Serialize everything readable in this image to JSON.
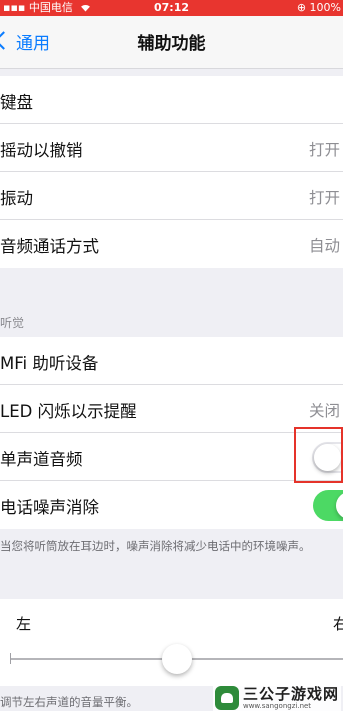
{
  "status_bar": {
    "carrier": "中国电信",
    "time": "07:12",
    "battery": "100%"
  },
  "nav": {
    "back_label": "通用",
    "title": "辅助功能"
  },
  "interaction_group": [
    {
      "label": "键盘",
      "value": ""
    },
    {
      "label": "摇动以撤销",
      "value": "打开"
    },
    {
      "label": "振动",
      "value": "打开"
    },
    {
      "label": "音频通话方式",
      "value": "自动"
    }
  ],
  "hearing": {
    "header": "听觉",
    "items": [
      {
        "label": "MFi 助听设备",
        "value": ""
      },
      {
        "label": "LED 闪烁以示提醒",
        "value": "关闭"
      },
      {
        "label": "单声道音频",
        "value": "",
        "toggle": false
      },
      {
        "label": "电话噪声消除",
        "value": "",
        "toggle": true
      }
    ],
    "footnote": "当您将听筒放在耳边时，噪声消除将减少电话中的环境噪声。"
  },
  "balance": {
    "left_label": "左",
    "right_label": "右",
    "position": 0.5,
    "note": "调节左右声道的音量平衡。"
  },
  "watermark": {
    "name": "三公子游戏网",
    "url": "www.sangongzi.net"
  },
  "colors": {
    "status_bar": "#e8352f",
    "accent": "#0a7cff",
    "toggle_on": "#4cd964",
    "highlight": "#e5332a"
  }
}
